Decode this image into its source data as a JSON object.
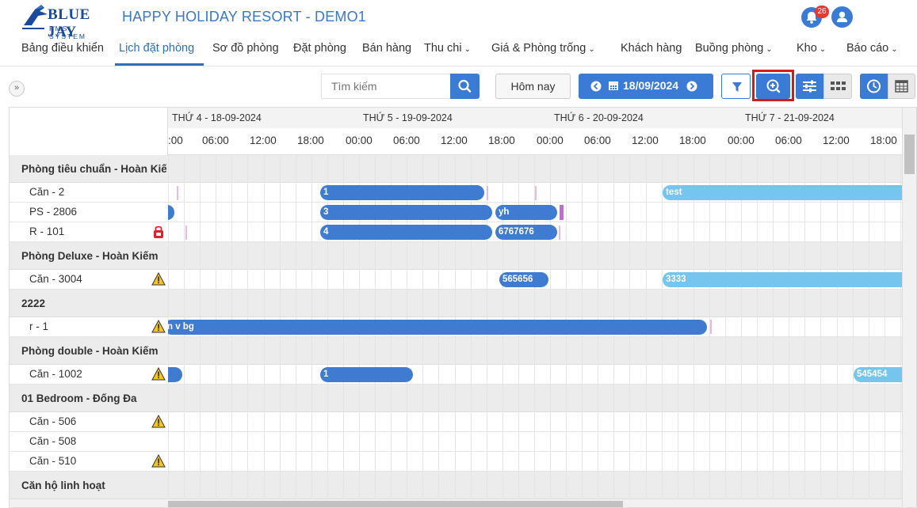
{
  "app": {
    "logo_text": "BLUE JAY",
    "logo_sub": "PMS SYSTEM",
    "title": "HAPPY HOLIDAY RESORT - DEMO1",
    "notification_count": "26"
  },
  "nav": {
    "items": [
      {
        "label": "Bảng điều khiển",
        "dropdown": false
      },
      {
        "label": "Lịch đặt phòng",
        "dropdown": false,
        "active": true
      },
      {
        "label": "Sơ đồ phòng",
        "dropdown": false
      },
      {
        "label": "Đặt phòng",
        "dropdown": false
      },
      {
        "label": "Bán hàng",
        "dropdown": false
      },
      {
        "label": "Thu chi",
        "dropdown": true
      },
      {
        "label": "Giá & Phòng trống",
        "dropdown": true
      },
      {
        "label": "Khách hàng",
        "dropdown": false
      },
      {
        "label": "Buồng phòng",
        "dropdown": true
      },
      {
        "label": "Kho",
        "dropdown": true
      },
      {
        "label": "Báo cáo",
        "dropdown": true
      }
    ]
  },
  "toolbar": {
    "search_placeholder": "Tìm kiếm",
    "today_label": "Hôm nay",
    "date_label": "18/09/2024"
  },
  "calendar": {
    "days": [
      "THỨ 4 - 18-09-2024",
      "THỨ 5 - 19-09-2024",
      "THỨ 6 - 20-09-2024",
      "THỨ 7 - 21-09-2024"
    ],
    "hours": [
      ":00",
      "06:00",
      "12:00",
      "18:00",
      "00:00",
      "06:00",
      "12:00",
      "18:00",
      "00:00",
      "06:00",
      "12:00",
      "18:00",
      "00:00",
      "06:00",
      "12:00",
      "18:00"
    ],
    "rows": [
      {
        "type": "group",
        "label": "Phòng tiêu chuẩn - Hoàn Kiếm"
      },
      {
        "type": "room",
        "label": "Căn - 2",
        "icon": ""
      },
      {
        "type": "room",
        "label": "PS - 2806",
        "icon": ""
      },
      {
        "type": "room",
        "label": "R - 101",
        "icon": "lock"
      },
      {
        "type": "group",
        "label": "Phòng Deluxe - Hoàn Kiếm"
      },
      {
        "type": "room",
        "label": "Căn - 3004",
        "icon": "warning"
      },
      {
        "type": "group",
        "label": "2222"
      },
      {
        "type": "room",
        "label": "r - 1",
        "icon": "warning"
      },
      {
        "type": "group",
        "label": "Phòng double - Hoàn Kiếm"
      },
      {
        "type": "room",
        "label": "Căn - 1002",
        "icon": "warning"
      },
      {
        "type": "group",
        "label": "01 Bedroom - Đống Đa"
      },
      {
        "type": "room",
        "label": "Căn - 506",
        "icon": "warning"
      },
      {
        "type": "room",
        "label": "Căn - 508",
        "icon": ""
      },
      {
        "type": "room",
        "label": "Căn - 510",
        "icon": "warning"
      },
      {
        "type": "group",
        "label": "Căn hộ linh hoạt"
      }
    ],
    "bookings": [
      {
        "row": 1,
        "label": "1",
        "style": "dark"
      },
      {
        "row": 1,
        "label": "test",
        "style": "light"
      },
      {
        "row": 2,
        "label": "",
        "style": "dark"
      },
      {
        "row": 2,
        "label": "3",
        "style": "dark"
      },
      {
        "row": 2,
        "label": "yh",
        "style": "dark"
      },
      {
        "row": 3,
        "label": "4",
        "style": "dark"
      },
      {
        "row": 3,
        "label": "6767676",
        "style": "dark"
      },
      {
        "row": 5,
        "label": "565656",
        "style": "dark"
      },
      {
        "row": 5,
        "label": "3333",
        "style": "light"
      },
      {
        "row": 7,
        "label": "n v bg",
        "style": "dark"
      },
      {
        "row": 9,
        "label": "",
        "style": "dark"
      },
      {
        "row": 9,
        "label": "1",
        "style": "dark"
      },
      {
        "row": 9,
        "label": "545454",
        "style": "light"
      }
    ]
  },
  "colors": {
    "primary": "#3a7bd5",
    "booking_dark": "#3f7bd1",
    "booking_light": "#75c5ee",
    "highlight": "#d61a1a"
  }
}
